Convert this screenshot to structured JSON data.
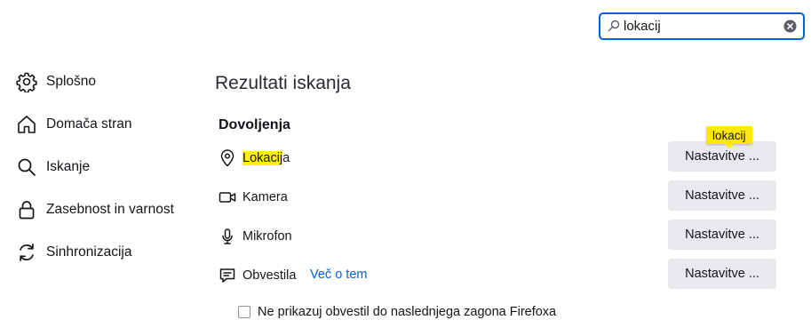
{
  "search": {
    "value": "lokacij",
    "icon": "search-icon",
    "clear_icon": "clear-icon",
    "accent": "#0061e0"
  },
  "sidebar": {
    "items": [
      {
        "label": "Splošno",
        "icon": "gear-icon"
      },
      {
        "label": "Domača stran",
        "icon": "home-icon"
      },
      {
        "label": "Iskanje",
        "icon": "search-icon"
      },
      {
        "label": "Zasebnost in varnost",
        "icon": "lock-icon"
      },
      {
        "label": "Sinhronizacija",
        "icon": "sync-icon"
      }
    ]
  },
  "main": {
    "title": "Rezultati iskanja",
    "section": "Dovoljenja",
    "tooltip": "lokacij",
    "permissions": [
      {
        "label_highlight": "Lokacij",
        "label_rest": "a",
        "icon": "location-pin-icon",
        "button": "Nastavitve ..."
      },
      {
        "label_highlight": "",
        "label_rest": "Kamera",
        "icon": "camera-icon",
        "button": "Nastavitve ..."
      },
      {
        "label_highlight": "",
        "label_rest": "Mikrofon",
        "icon": "microphone-icon",
        "button": "Nastavitve ..."
      },
      {
        "label_highlight": "",
        "label_rest": "Obvestila",
        "icon": "notification-icon",
        "button": "Nastavitve ..."
      }
    ],
    "more_link": "Več o tem",
    "checkbox_label": "Ne prikazuj obvestil do naslednjega zagona Firefoxa",
    "checkbox_checked": false,
    "highlight_color": "#fff200",
    "tooltip_color": "#ffe900"
  }
}
